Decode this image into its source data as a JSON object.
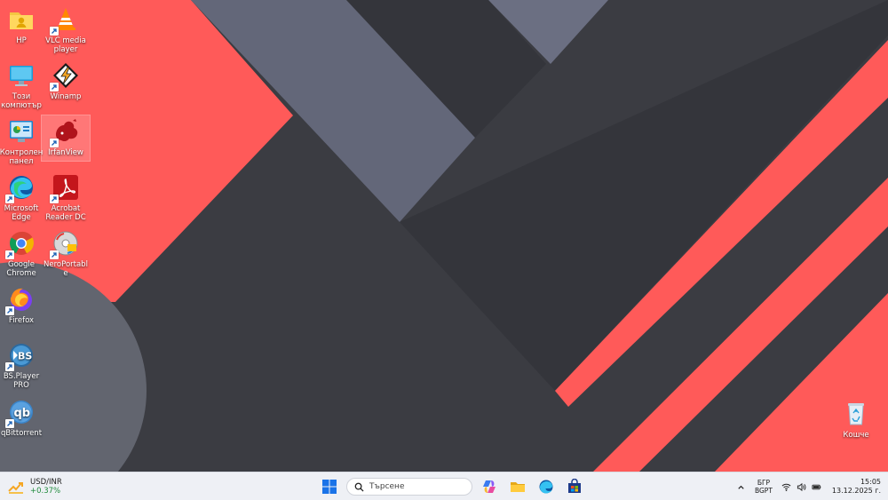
{
  "desktop": {
    "icons": [
      {
        "label": "HP"
      },
      {
        "label": "VLC media player"
      },
      {
        "label": "Този компютър"
      },
      {
        "label": "Winamp"
      },
      {
        "label": "Контролен панел"
      },
      {
        "label": "IrfanView"
      },
      {
        "label": "Microsoft Edge"
      },
      {
        "label": "Acrobat Reader DC"
      },
      {
        "label": "Google Chrome"
      },
      {
        "label": "NeroPortable"
      },
      {
        "label": "Firefox"
      },
      {
        "label": "BS.Player PRO"
      },
      {
        "label": "qBittorrent"
      },
      {
        "label": "Кошче"
      }
    ]
  },
  "colors": {
    "wallpaper_red": "#ff5a59",
    "wallpaper_dark": "#3b3c42",
    "wallpaper_slate": "#636779",
    "taskbar_bg": "#eef0f5",
    "widget_positive": "#1f8a3b"
  },
  "taskbar": {
    "widget": {
      "title": "USD/INR",
      "change": "+0.37%",
      "icon": "chart-icon"
    },
    "search": {
      "placeholder": "Търсене"
    },
    "pinned": [
      "start-icon",
      "copilot-icon",
      "file-explorer-icon",
      "edge-icon",
      "store-icon"
    ],
    "tray": {
      "lang_line1": "БГР",
      "lang_line2": "BGPT",
      "time": "15:05",
      "date": "13.12.2025 г."
    }
  }
}
